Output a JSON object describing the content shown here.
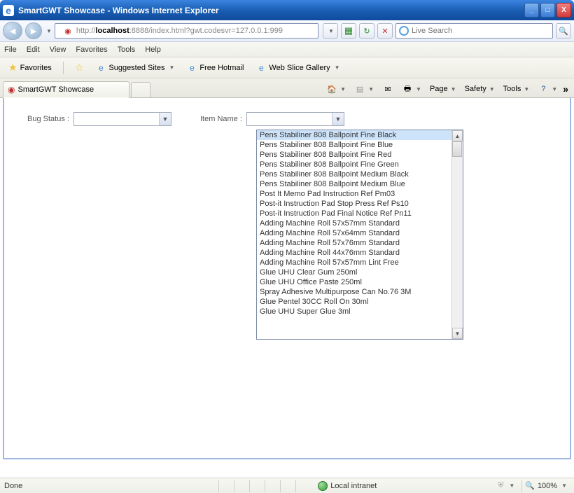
{
  "window": {
    "title": "SmartGWT Showcase - Windows Internet Explorer"
  },
  "addressBar": {
    "protocol": "http://",
    "host": "localhost",
    "rest": ":8888/index.html?gwt.codesvr=127.0.0.1:999"
  },
  "search": {
    "placeholder": "Live Search"
  },
  "menuBar": {
    "file": "File",
    "edit": "Edit",
    "view": "View",
    "favorites": "Favorites",
    "tools": "Tools",
    "help": "Help"
  },
  "favBar": {
    "favorites": "Favorites",
    "suggested": "Suggested Sites",
    "hotmail": "Free Hotmail",
    "webslice": "Web Slice Gallery"
  },
  "tab": {
    "title": "SmartGWT Showcase"
  },
  "cmdBar": {
    "page": "Page",
    "safety": "Safety",
    "tools": "Tools"
  },
  "form": {
    "bugStatusLabel": "Bug Status :",
    "itemNameLabel": "Item Name :"
  },
  "dropdown": {
    "items": [
      "Pens Stabiliner 808 Ballpoint Fine Black",
      "Pens Stabiliner 808 Ballpoint Fine Blue",
      "Pens Stabiliner 808 Ballpoint Fine Red",
      "Pens Stabiliner 808 Ballpoint Fine Green",
      "Pens Stabiliner 808 Ballpoint Medium Black",
      "Pens Stabiliner 808 Ballpoint Medium Blue",
      "Post It Memo Pad Instruction Ref Pm03",
      "Post-it Instruction Pad Stop Press Ref Ps10",
      "Post-it Instruction Pad Final Notice Ref Pn11",
      "Adding Machine Roll 57x57mm Standard",
      "Adding Machine Roll 57x64mm Standard",
      "Adding Machine Roll 57x76mm Standard",
      "Adding Machine Roll 44x76mm Standard",
      "Adding Machine Roll 57x57mm Lint Free",
      "Glue UHU Clear Gum 250ml",
      "Glue UHU Office Paste 250ml",
      "Spray Adhesive Multipurpose Can No.76 3M",
      "Glue Pentel 30CC Roll On 30ml",
      "Glue UHU Super Glue 3ml"
    ]
  },
  "statusBar": {
    "status": "Done",
    "zone": "Local intranet",
    "zoom": "100%"
  }
}
